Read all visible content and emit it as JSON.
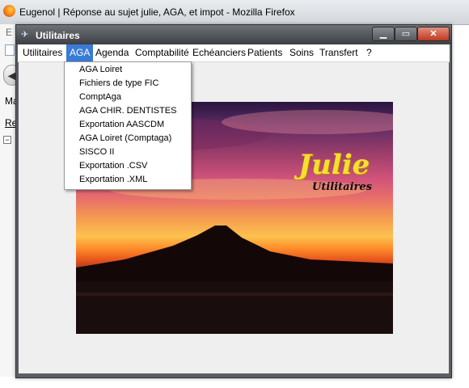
{
  "browser": {
    "title": "Eugenol | Réponse au sujet julie, AGA, et impot - Mozilla Firefox",
    "menu_peek": "E",
    "sidebar_peek_1": "Ma",
    "sidebar_peek_2": "Re",
    "tree_toggle": "−",
    "back_arrow": "◀"
  },
  "dialog": {
    "title": "Utilitaires",
    "icon": "✈",
    "window_buttons": {
      "minimize": "▁",
      "maximize": "▭",
      "close": "✕"
    },
    "menubar": [
      "Utilitaires",
      "AGA",
      "Agenda",
      "Comptabilité",
      "Echéanciers",
      "Patients",
      "Soins",
      "Transfert",
      "?"
    ],
    "active_menu": "AGA",
    "aga_menu": [
      "AGA Loiret",
      "Fichiers de type FIC",
      "ComptAga",
      "AGA CHIR. DENTISTES",
      "Exportation AASCDM",
      "AGA Loiret (Comptaga)",
      "SISCO II",
      "Exportation .CSV",
      "Exportation .XML"
    ]
  },
  "splash": {
    "title": "Julie",
    "subtitle": "Utilitaires"
  },
  "colors": {
    "menu_highlight": "#3a7bd5",
    "title_gold": "#f5e030"
  }
}
